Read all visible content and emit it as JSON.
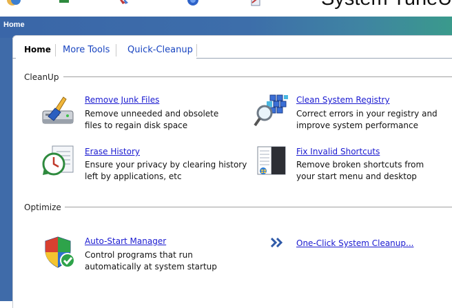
{
  "window": {
    "app_title": "System TuneUp",
    "header_title": "Home"
  },
  "tabs": [
    {
      "label": "Home",
      "active": true
    },
    {
      "label": "More Tools",
      "active": false
    },
    {
      "label": "Quick-Cleanup",
      "active": false
    }
  ],
  "sections": {
    "cleanup": {
      "title": "CleanUp",
      "items": [
        {
          "label": "Remove Junk Files",
          "desc_line1": "Remove unneeded and obsolete",
          "desc_line2": "files to regain disk space",
          "icon": "broom-drive-icon"
        },
        {
          "label": "Clean System Registry",
          "desc_line1": "Correct errors in your registry and",
          "desc_line2": "improve system performance",
          "icon": "registry-magnifier-icon"
        },
        {
          "label": "Erase History",
          "desc_line1": "Ensure your privacy by clearing history",
          "desc_line2": "left by applications, etc",
          "icon": "history-clock-icon"
        },
        {
          "label": "Fix Invalid Shortcuts",
          "desc_line1": "Remove broken shortcuts from",
          "desc_line2": "your start menu and desktop",
          "icon": "start-menu-icon"
        }
      ]
    },
    "optimize": {
      "title": "Optimize",
      "items": [
        {
          "label": "Auto-Start Manager",
          "desc_line1": "Control programs that run",
          "desc_line2": "automatically at system startup",
          "icon": "shield-check-icon"
        },
        {
          "label": "One-Click System Cleanup...",
          "icon": "double-chevron-right-icon"
        }
      ]
    }
  },
  "colors": {
    "header_start": "#3a66a8",
    "header_end": "#3a9a8c",
    "link": "#1a1ad0"
  }
}
